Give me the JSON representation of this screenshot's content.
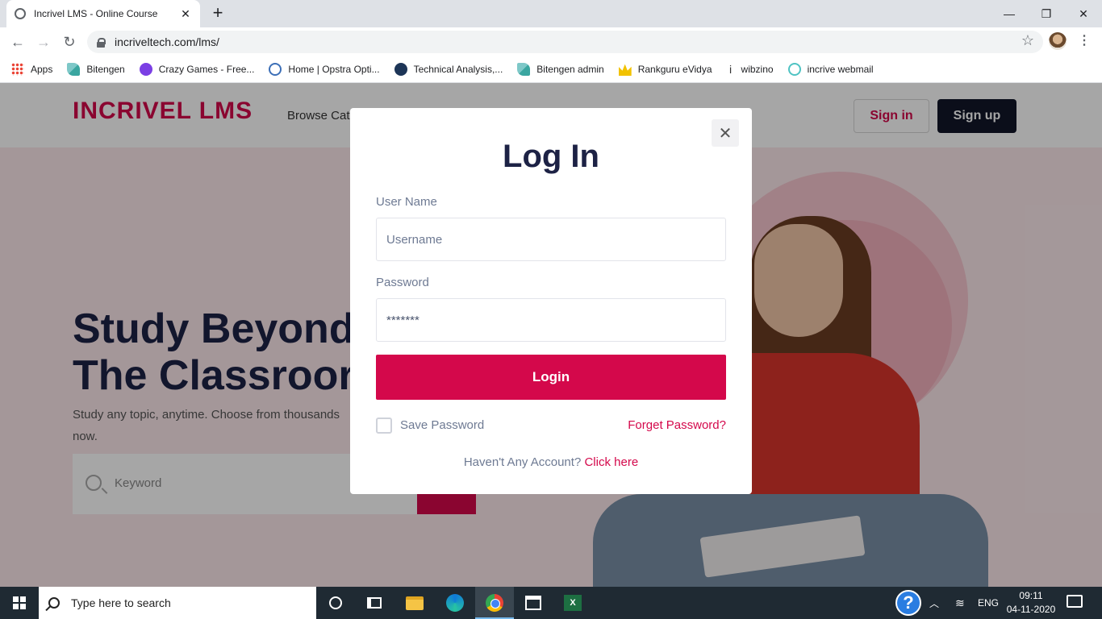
{
  "browser": {
    "tab_title": "Incrivel LMS - Online Course",
    "tab_close": "✕",
    "new_tab": "+",
    "url": "incriveltech.com/lms/",
    "window_controls": {
      "minimize": "—",
      "maximize": "❐",
      "close": "✕"
    },
    "nav": {
      "back": "←",
      "forward": "→",
      "reload": "↻"
    },
    "star": "☆",
    "menu": "⋮"
  },
  "bookmarks": [
    {
      "label": "Apps",
      "icon": "apps-grid-icon"
    },
    {
      "label": "Bitengen",
      "icon": "bitengen-icon"
    },
    {
      "label": "Crazy Games - Free...",
      "icon": "crazygames-icon"
    },
    {
      "label": "Home | Opstra Opti...",
      "icon": "opstra-icon"
    },
    {
      "label": "Technical Analysis,...",
      "icon": "technical-analysis-icon"
    },
    {
      "label": "Bitengen admin",
      "icon": "bitengen-icon"
    },
    {
      "label": "Rankguru eVidya",
      "icon": "rankguru-icon"
    },
    {
      "label": "wibzino",
      "icon": "info-icon"
    },
    {
      "label": "incrive webmail",
      "icon": "webmail-icon"
    }
  ],
  "site": {
    "brand": "INCRIVEL LMS",
    "browse": "Browse Cat",
    "signin": "Sign in",
    "signup": "Sign up",
    "hero_title": "Study Beyond\nThe Classroor",
    "hero_sub": "Study any topic, anytime. Choose from thousands\nnow.",
    "search_placeholder": "Keyword"
  },
  "modal": {
    "close": "✕",
    "title": "Log In",
    "username_label": "User Name",
    "username_placeholder": "Username",
    "password_label": "Password",
    "password_value": "*******",
    "login": "Login",
    "save_password": "Save Password",
    "forget_password": "Forget Password?",
    "no_account": "Haven't Any Account?",
    "click_here": "Click here"
  },
  "taskbar": {
    "search_text": "Type here to search",
    "help": "?",
    "chevron": "︿",
    "language": "ENG",
    "time": "09:11",
    "date": "04-11-2020",
    "excel_letter": "X"
  }
}
